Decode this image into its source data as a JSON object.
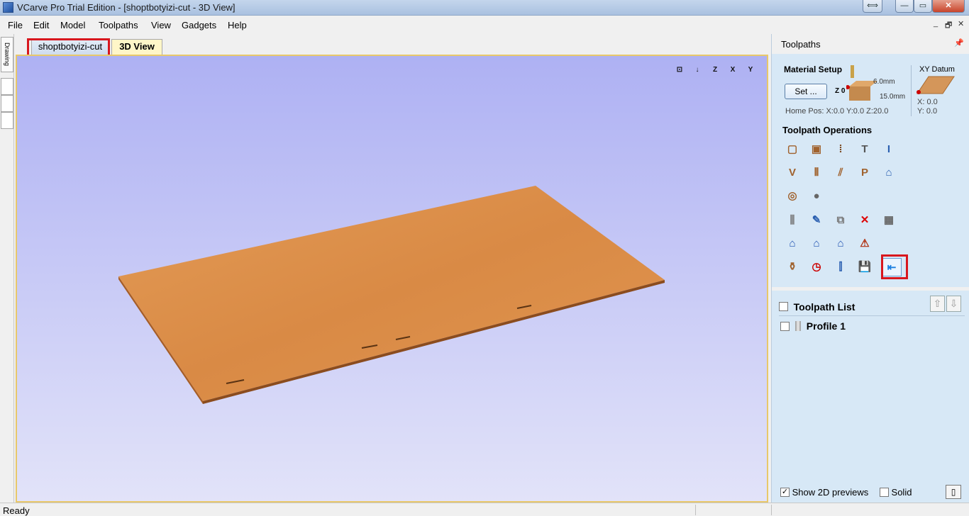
{
  "window": {
    "title": "VCarve Pro Trial Edition - [shoptbotyizi-cut - 3D View]",
    "buttons": {
      "resize": "⟺",
      "minimize": "—",
      "maximize": "▭",
      "close": "✕"
    }
  },
  "menu": {
    "items": [
      "File",
      "Edit",
      "Model",
      "Toolpaths",
      "View",
      "Gadgets",
      "Help"
    ],
    "mdi": {
      "minimize": "_",
      "restore": "🗗",
      "close": "✕"
    }
  },
  "left_strip": {
    "label": "Drawing"
  },
  "tabs": [
    {
      "label": "shoptbotyizi-cut",
      "active": false
    },
    {
      "label": "3D View",
      "active": true
    }
  ],
  "viewport": {
    "view_icons": [
      "⊡",
      "↓",
      "Z",
      "X",
      "Y"
    ],
    "material_color": "#d98a45",
    "background_top": "#aeb1f3",
    "background_bottom": "#e2e3f9"
  },
  "panel": {
    "title": "Toolpaths",
    "pin": "📌",
    "material_setup": {
      "title": "Material Setup",
      "set_button": "Set ...",
      "z0_label": "Z 0",
      "top_dim": "6.0mm",
      "thickness_dim": "15.0mm",
      "home_pos": "Home Pos:  X:0.0 Y:0.0 Z:20.0"
    },
    "xy_datum": {
      "title": "XY Datum",
      "x": "X: 0.0",
      "y": "Y: 0.0"
    },
    "operations_title": "Toolpath Operations",
    "toolpath_list_title": "Toolpath List",
    "toolpaths": [
      {
        "name": "Profile 1",
        "checked": false
      }
    ],
    "show_2d_previews": {
      "label": "Show 2D previews",
      "checked": true
    },
    "solid": {
      "label": "Solid",
      "checked": false
    }
  },
  "status": {
    "text": "Ready"
  }
}
